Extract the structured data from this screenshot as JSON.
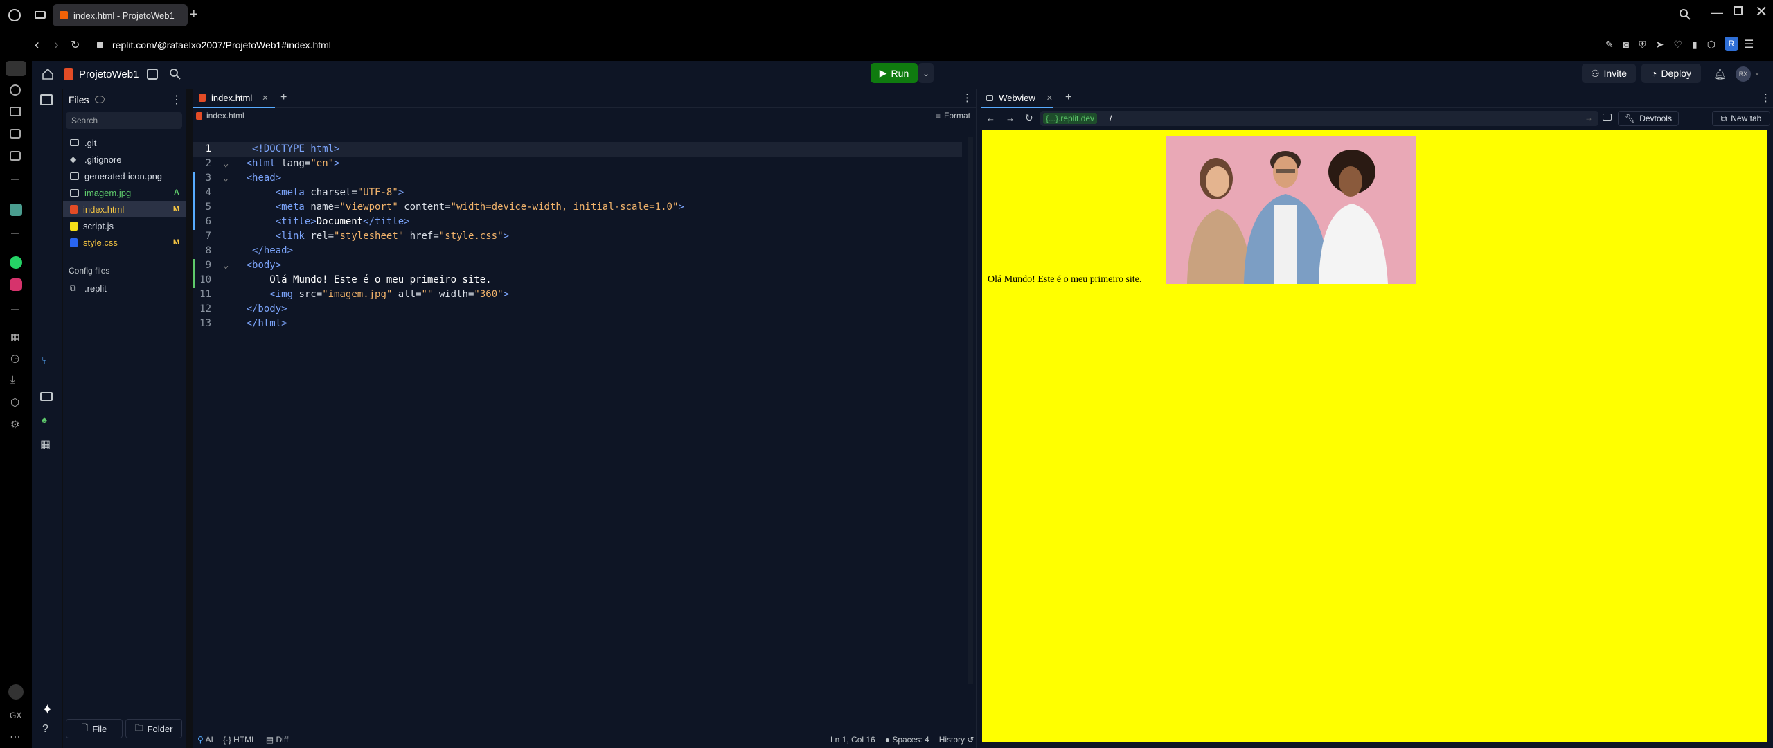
{
  "browser": {
    "tab_title": "index.html - ProjetoWeb1",
    "url": "replit.com/@rafaelxo2007/ProjetoWeb1#index.html",
    "avatar_letter": "R"
  },
  "header": {
    "project_name": "ProjetoWeb1",
    "run_label": "Run",
    "invite_label": "Invite",
    "deploy_label": "Deploy",
    "user_initials": "RX"
  },
  "files": {
    "title": "Files",
    "search_placeholder": "Search",
    "items": [
      {
        "name": ".git",
        "badge": ""
      },
      {
        "name": ".gitignore",
        "badge": ""
      },
      {
        "name": "generated-icon.png",
        "badge": ""
      },
      {
        "name": "imagem.jpg",
        "badge": "A"
      },
      {
        "name": "index.html",
        "badge": "M"
      },
      {
        "name": "script.js",
        "badge": ""
      },
      {
        "name": "style.css",
        "badge": "M"
      }
    ],
    "config_title": "Config files",
    "config_items": [
      {
        "name": ".replit"
      }
    ],
    "new_file_label": "File",
    "new_folder_label": "Folder"
  },
  "editor": {
    "tab_label": "index.html",
    "breadcrumb": "index.html",
    "format_label": "Format",
    "status": {
      "ai": "AI",
      "lang": "HTML",
      "diff": "Diff",
      "position": "Ln 1, Col 16",
      "spaces": "Spaces: 4",
      "history": "History"
    }
  },
  "webview": {
    "tab_label": "Webview",
    "domain": "{...}.replit.dev",
    "path": "/",
    "devtools_label": "Devtools",
    "newtab_label": "New tab",
    "page_text": "Olá Mundo! Este é o meu primeiro site.",
    "page_bg": "#ffff00"
  },
  "colors": {
    "run_green": "#0f7b0f",
    "modified": "#f5c542",
    "added": "#5ec96b"
  }
}
